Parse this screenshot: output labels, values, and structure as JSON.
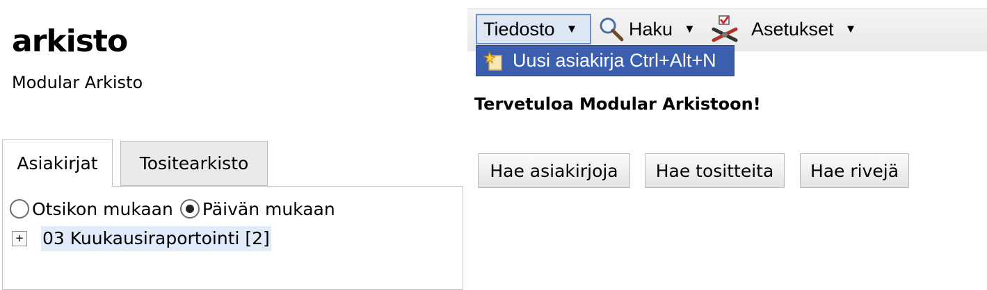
{
  "header": {
    "title": "arkisto",
    "subtitle": "Modular Arkisto"
  },
  "tabs": [
    {
      "label": "Asiakirjat",
      "active": true
    },
    {
      "label": "Tositearkisto",
      "active": false
    }
  ],
  "sort_options": [
    {
      "label": "Otsikon mukaan",
      "selected": false
    },
    {
      "label": "Päivän mukaan",
      "selected": true
    }
  ],
  "tree": {
    "items": [
      {
        "label": "03 Kuukausiraportointi [2]",
        "expander": "+"
      }
    ]
  },
  "menubar": {
    "file": "Tiedosto",
    "search": "Haku",
    "settings": "Asetukset",
    "caret": "▼"
  },
  "dropdown": {
    "items": [
      {
        "label": "Uusi asiakirja Ctrl+Alt+N",
        "icon": "new-document-star-icon"
      }
    ]
  },
  "main": {
    "welcome": "Tervetuloa Modular Arkistoon!",
    "buttons": [
      "Hae asiakirjoja",
      "Hae tositteita",
      "Hae rivejä"
    ]
  },
  "colors": {
    "menu_highlight": "#3b5fae",
    "tree_selection": "#e1ebfa"
  }
}
